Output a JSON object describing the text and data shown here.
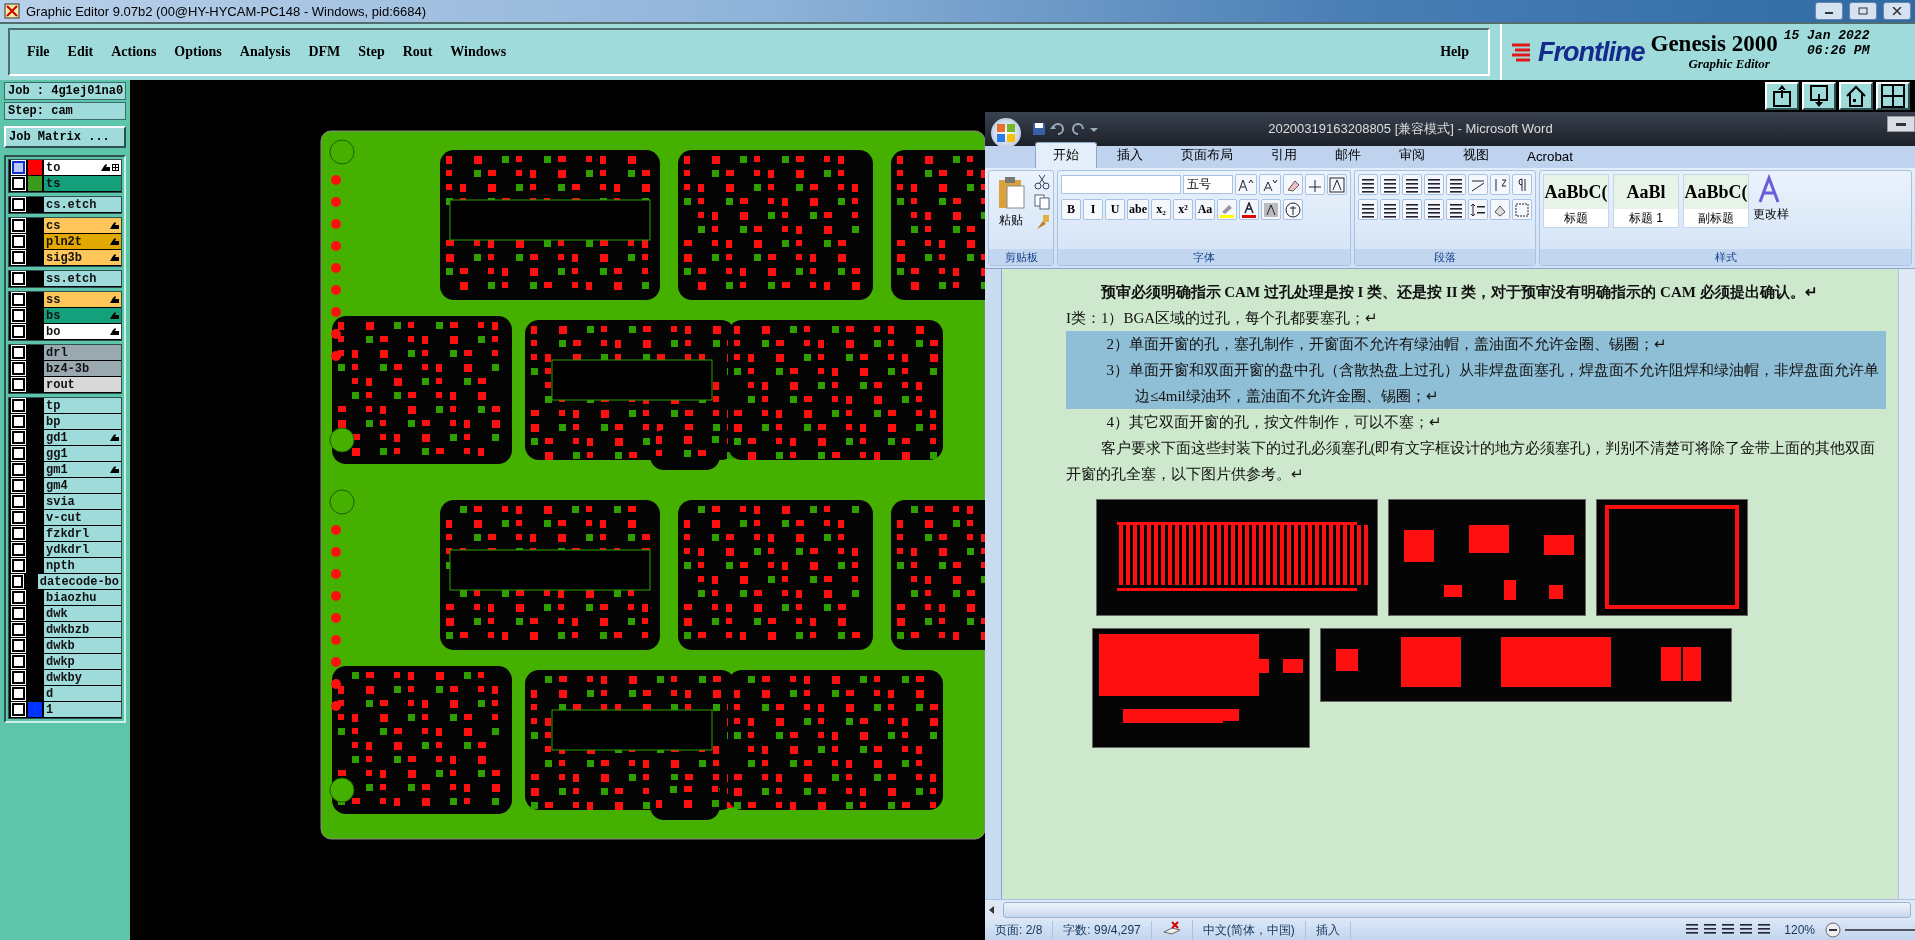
{
  "os_window": {
    "title": "Graphic Editor 9.07b2 (00@HY-HYCAM-PC148 - Windows, pid:6684)"
  },
  "menu": {
    "items": [
      "File",
      "Edit",
      "Actions",
      "Options",
      "Analysis",
      "DFM",
      "Step",
      "Rout",
      "Windows"
    ],
    "help": "Help"
  },
  "brand": {
    "logo": "Frontline",
    "product": "Genesis 2000",
    "subtitle": "Graphic Editor",
    "date": "15 Jan 2022",
    "time": "06:26 PM"
  },
  "job": {
    "job": "Job : 4g1ej01na0",
    "step": "Step: cam",
    "matrix_button": "Job Matrix ..."
  },
  "layer_groups": [
    [
      {
        "name": "to",
        "color": "#ffffff",
        "swatch": {
          "color": "#ff0000"
        },
        "work": true,
        "affected": true
      },
      {
        "name": "ts",
        "color": "#13a07a",
        "swatch": {
          "color": "#3c9a1e"
        },
        "work": false,
        "affected": false
      }
    ],
    [
      {
        "name": "cs.etch",
        "color": "#9fdbdb",
        "work": false,
        "affected": false
      }
    ],
    [
      {
        "name": "cs",
        "color": "#ffc75a",
        "work": false,
        "affected": true
      },
      {
        "name": "pln2t",
        "color": "#e0a800",
        "work": false,
        "affected": true
      },
      {
        "name": "sig3b",
        "color": "#ffc75a",
        "work": false,
        "affected": true
      }
    ],
    [
      {
        "name": "ss.etch",
        "color": "#9fdbdb",
        "work": false,
        "affected": false
      }
    ],
    [
      {
        "name": "ss",
        "color": "#ffc75a",
        "work": false,
        "affected": true
      },
      {
        "name": "bs",
        "color": "#13a07a",
        "work": false,
        "affected": true
      },
      {
        "name": "bo",
        "color": "#ffffff",
        "work": false,
        "affected": true
      }
    ],
    [
      {
        "name": "drl",
        "color": "#9aa9b0",
        "work": false,
        "affected": false
      },
      {
        "name": "bz4-3b",
        "color": "#9aa9b0",
        "work": false,
        "affected": false
      },
      {
        "name": "rout",
        "color": "#d8d8d8",
        "work": false,
        "affected": false
      }
    ],
    [
      {
        "name": "tp",
        "color": "#9fdbdb",
        "work": false,
        "affected": false
      },
      {
        "name": "bp",
        "color": "#9fdbdb",
        "work": false,
        "affected": false
      },
      {
        "name": "gd1",
        "color": "#9fdbdb",
        "work": false,
        "affected": true
      },
      {
        "name": "gg1",
        "color": "#9fdbdb",
        "work": false,
        "affected": false
      },
      {
        "name": "gm1",
        "color": "#9fdbdb",
        "work": false,
        "affected": true
      },
      {
        "name": "gm4",
        "color": "#9fdbdb",
        "work": false,
        "affected": false
      },
      {
        "name": "svia",
        "color": "#9fdbdb",
        "work": false,
        "affected": false
      },
      {
        "name": "v-cut",
        "color": "#9fdbdb",
        "work": false,
        "affected": false
      },
      {
        "name": "fzkdrl",
        "color": "#9fdbdb",
        "work": false,
        "affected": false
      },
      {
        "name": "ydkdrl",
        "color": "#9fdbdb",
        "work": false,
        "affected": false
      },
      {
        "name": "npth",
        "color": "#9fdbdb",
        "work": false,
        "affected": false
      },
      {
        "name": "datecode-bo",
        "color": "#9fdbdb",
        "work": false,
        "affected": false
      },
      {
        "name": "biaozhu",
        "color": "#9fdbdb",
        "work": false,
        "affected": false
      },
      {
        "name": "dwk",
        "color": "#9fdbdb",
        "work": false,
        "affected": false
      },
      {
        "name": "dwkbzb",
        "color": "#9fdbdb",
        "work": false,
        "affected": false
      },
      {
        "name": "dwkb",
        "color": "#9fdbdb",
        "work": false,
        "affected": false
      },
      {
        "name": "dwkp",
        "color": "#9fdbdb",
        "work": false,
        "affected": false
      },
      {
        "name": "dwkby",
        "color": "#9fdbdb",
        "work": false,
        "affected": false
      },
      {
        "name": "d",
        "color": "#9fdbdb",
        "work": false,
        "affected": false
      },
      {
        "name": "1",
        "color": "#9fdbdb",
        "swatch": {
          "color": "#0033ff"
        },
        "work": false,
        "affected": false
      }
    ]
  ],
  "word": {
    "title": "20200319163208805 [兼容模式]  -  Microsoft Word",
    "tabs": [
      {
        "label": "开始",
        "selected": true
      },
      {
        "label": "插入",
        "selected": false
      },
      {
        "label": "页面布局",
        "selected": false
      },
      {
        "label": "引用",
        "selected": false
      },
      {
        "label": "邮件",
        "selected": false
      },
      {
        "label": "审阅",
        "selected": false
      },
      {
        "label": "视图",
        "selected": false
      },
      {
        "label": "Acrobat",
        "selected": false
      }
    ],
    "ribbon": {
      "paste": "粘贴",
      "font_size": "五号",
      "font_buttons": [
        "B",
        "I",
        "U",
        "abe",
        "x₂",
        "x²",
        "Aa"
      ],
      "styles": [
        {
          "sample": "AaBbC(",
          "name": "标题"
        },
        {
          "sample": "AaBl",
          "name": "标题 1"
        },
        {
          "sample": "AaBbC(",
          "name": "副标题"
        }
      ],
      "change_styles": "更改样",
      "groups": [
        "剪贴板",
        "字体",
        "段落",
        "样式"
      ]
    },
    "paragraphs": [
      {
        "kind": "lead",
        "bold": true,
        "selected": false,
        "text": "预审必须明确指示 CAM 过孔处理是按 I 类、还是按 II 类，对于预审没有明确指示的 CAM 必须提出确认。↵"
      },
      {
        "kind": "flush",
        "bold": false,
        "selected": false,
        "text": "I类：1）BGA区域的过孔，每个孔都要塞孔；↵"
      },
      {
        "kind": "item",
        "bold": false,
        "selected": true,
        "text": "2）单面开窗的孔，塞孔制作，开窗面不允许有绿油帽，盖油面不允许金圈、锡圈；↵"
      },
      {
        "kind": "item",
        "bold": false,
        "selected": true,
        "text": "3）单面开窗和双面开窗的盘中孔（含散热盘上过孔）从非焊盘面塞孔，焊盘面不允许阻焊和绿油帽，非焊盘面允许单边≤4mil绿油环，盖油面不允许金圈、锡圈；↵"
      },
      {
        "kind": "item",
        "bold": false,
        "selected": false,
        "text": "4）其它双面开窗的孔，按文件制作，可以不塞；↵"
      },
      {
        "kind": "lead",
        "bold": false,
        "selected": false,
        "text": "客户要求下面这些封装下的过孔必须塞孔(即有文字框设计的地方必须塞孔)，判别不清楚可将除了金带上面的其他双面开窗的孔全塞，以下图片供参考。↵"
      }
    ],
    "status": {
      "page": "页面: 2/8",
      "words": "字数: 99/4,297",
      "language": "中文(简体，中国)",
      "mode": "插入",
      "zoom": "120%"
    }
  }
}
